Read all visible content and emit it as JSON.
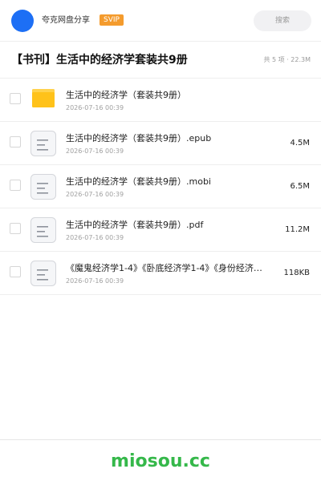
{
  "header": {
    "username": "夸克网盘分享",
    "badge": "SVIP",
    "search_placeholder": "搜索"
  },
  "share": {
    "title": "【书刊】生活中的经济学套装共9册",
    "stats": "共 5 项 · 22.3M"
  },
  "files": [
    {
      "name": "生活中的经济学（套装共9册）",
      "date": "2026-07-16 00:39",
      "size": "",
      "type": "folder"
    },
    {
      "name": "生活中的经济学（套装共9册）.epub",
      "date": "2026-07-16 00:39",
      "size": "4.5M",
      "type": "document"
    },
    {
      "name": "生活中的经济学（套装共9册）.mobi",
      "date": "2026-07-16 00:39",
      "size": "6.5M",
      "type": "document"
    },
    {
      "name": "生活中的经济学（套装共9册）.pdf",
      "date": "2026-07-16 00:39",
      "size": "11.2M",
      "type": "document"
    },
    {
      "name": "《魔鬼经济学1-4》《卧底经济学1-4》《身份经济…",
      "date": "2026-07-16 00:39",
      "size": "118KB",
      "type": "document"
    }
  ],
  "footer": {
    "watermark": "miosou.cc"
  },
  "colors": {
    "accent": "#1d6ff5",
    "badge": "#f49b2d",
    "folder": "#ffc21a",
    "watermark": "#35b84a"
  }
}
